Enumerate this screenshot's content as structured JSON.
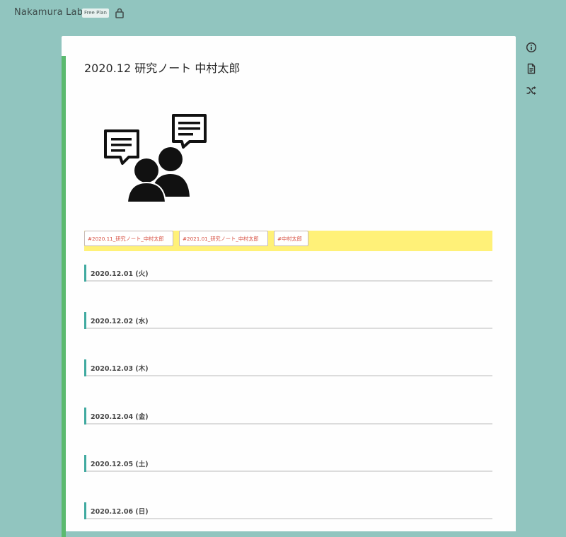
{
  "project": {
    "name": "Nakamura Lab",
    "plan": "Free Plan"
  },
  "page": {
    "title": "2020.12 研究ノート 中村太郎",
    "image_alt_icons": [
      "chat-bubble-icon",
      "chat-bubble-icon",
      "people-icon"
    ],
    "tags": [
      "#2020.11_研究ノート_中村太郎",
      "#2021.01_研究ノート_中村太郎",
      "#中村太郎"
    ],
    "days": [
      "2020.12.01 (火)",
      "2020.12.02 (水)",
      "2020.12.03 (木)",
      "2020.12.04 (金)",
      "2020.12.05 (土)",
      "2020.12.06 (日)"
    ]
  },
  "sidebar_actions": [
    "info-icon",
    "document-icon",
    "shuffle-icon"
  ],
  "colors": {
    "background": "#91c5bf",
    "page_accent": "#5bba6f",
    "heading_bar": "#40aaa0",
    "tag_highlight": "#fff178",
    "tag_text": "#d74f41"
  }
}
